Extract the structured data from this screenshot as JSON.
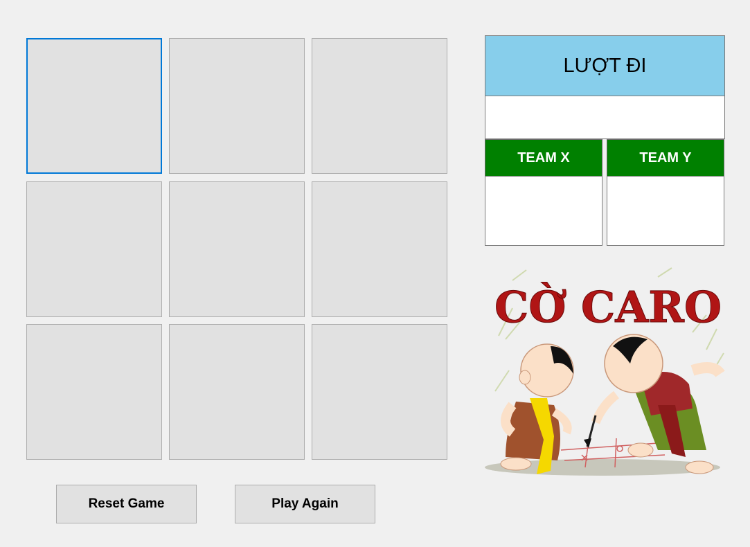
{
  "board": {
    "cells": [
      "",
      "",
      "",
      "",
      "",
      "",
      "",
      "",
      ""
    ]
  },
  "buttons": {
    "reset_label": "Reset Game",
    "play_again_label": "Play Again"
  },
  "turn_panel": {
    "title": "LƯỢT ĐI",
    "current": ""
  },
  "teams": {
    "x_label": "TEAM X",
    "x_score": "",
    "y_label": "TEAM Y",
    "y_score": ""
  },
  "logo": {
    "text": "CỜ CARO"
  },
  "colors": {
    "turn_header_bg": "#87ceeb",
    "team_header_bg": "#008000",
    "focus_border": "#0078d7",
    "logo_text": "#b01515"
  }
}
